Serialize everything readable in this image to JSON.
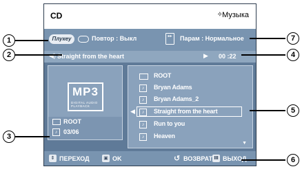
{
  "header": {
    "title": "CD",
    "mode_label": "Музыка"
  },
  "controls": {
    "pill_label": "Плукеу",
    "repeat": "Повтор : Выкл",
    "params": "Парам : Нормальное"
  },
  "now_playing": {
    "track": "Straight from the heart",
    "time": "00 :22"
  },
  "left_panel": {
    "logo_text": "MP3",
    "logo_subtext": "DIGITAL AUDIO PLAYBACK",
    "folder": "ROOT",
    "counter": "03/06"
  },
  "file_list": {
    "items": [
      {
        "label": "ROOT",
        "icon": "folder-icon"
      },
      {
        "label": "Bryan Adams",
        "icon": "music-note-icon"
      },
      {
        "label": "Bryan Adams_2",
        "icon": "music-note-icon"
      },
      {
        "label": "Straight from the heart",
        "icon": "music-note-icon",
        "selected": true
      },
      {
        "label": "Run to you",
        "icon": "music-note-icon"
      },
      {
        "label": "Heaven",
        "icon": "music-note-icon"
      }
    ]
  },
  "bottom_bar": {
    "move": "ПЕРЕХОД",
    "ok": "OK",
    "back": "ВОЗВРАТ",
    "exit": "ВЫХОД"
  },
  "callouts": [
    "1",
    "2",
    "3",
    "4",
    "5",
    "6",
    "7"
  ]
}
